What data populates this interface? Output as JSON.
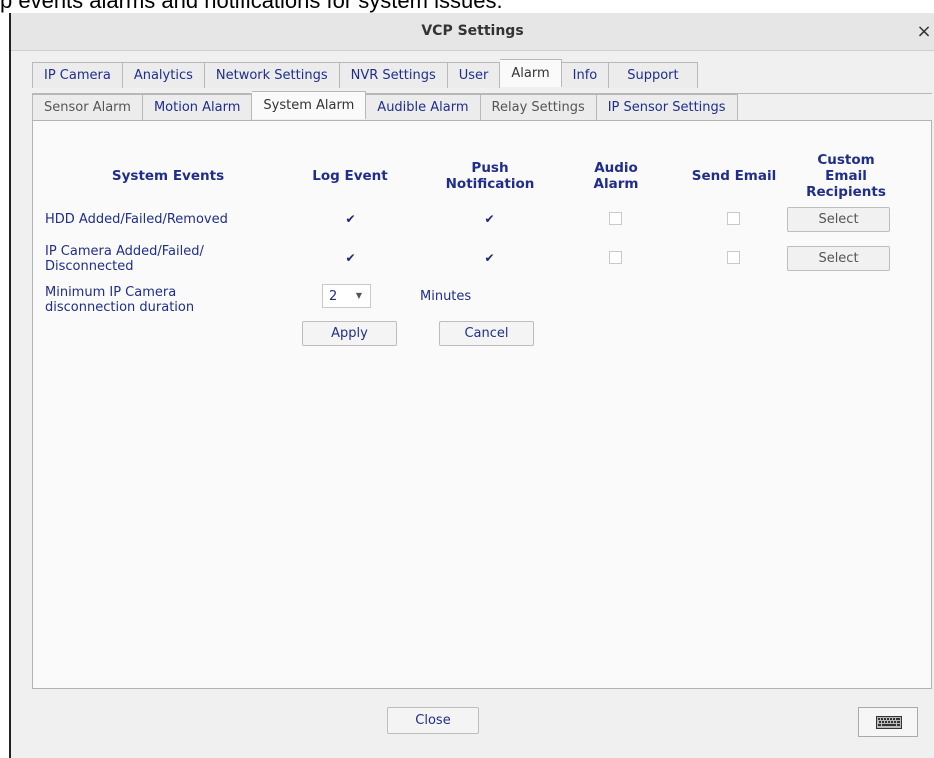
{
  "caption": "p events alarms and notifications for system issues.",
  "window": {
    "title": "VCP Settings",
    "close_glyph": "×"
  },
  "main_tabs": [
    {
      "label": "IP Camera"
    },
    {
      "label": "Analytics"
    },
    {
      "label": "Network Settings"
    },
    {
      "label": "NVR Settings"
    },
    {
      "label": "User"
    },
    {
      "label": "Alarm",
      "active": true
    },
    {
      "label": "Info"
    },
    {
      "label": "Support"
    }
  ],
  "sub_tabs": [
    {
      "label": "Sensor Alarm"
    },
    {
      "label": "Motion Alarm"
    },
    {
      "label": "System Alarm",
      "active": true
    },
    {
      "label": "Audible Alarm"
    },
    {
      "label": "Relay Settings"
    },
    {
      "label": "IP Sensor Settings"
    }
  ],
  "table": {
    "headers": {
      "events": "System Events",
      "log": "Log Event",
      "push": "Push Notification",
      "audio": "Audio Alarm",
      "email": "Send Email",
      "custom": "Custom Email Recipients"
    },
    "rows": [
      {
        "event": "HDD Added/Failed/Removed",
        "log": true,
        "push": true,
        "audio": false,
        "email": false,
        "select_label": "Select"
      },
      {
        "event": "IP Camera Added/Failed/ Disconnected",
        "log": true,
        "push": true,
        "audio": false,
        "email": false,
        "select_label": "Select"
      }
    ],
    "check_glyph": "✔"
  },
  "duration": {
    "label": "Minimum IP Camera disconnection duration",
    "value": "2",
    "unit": "Minutes"
  },
  "actions": {
    "apply": "Apply",
    "cancel": "Cancel"
  },
  "footer": {
    "close": "Close",
    "keyboard_icon": "keyboard-icon"
  },
  "colors": {
    "label_blue": "#1f2e8c",
    "dialog_bg": "#f0f0f0",
    "panel_bg": "#fafafa"
  }
}
